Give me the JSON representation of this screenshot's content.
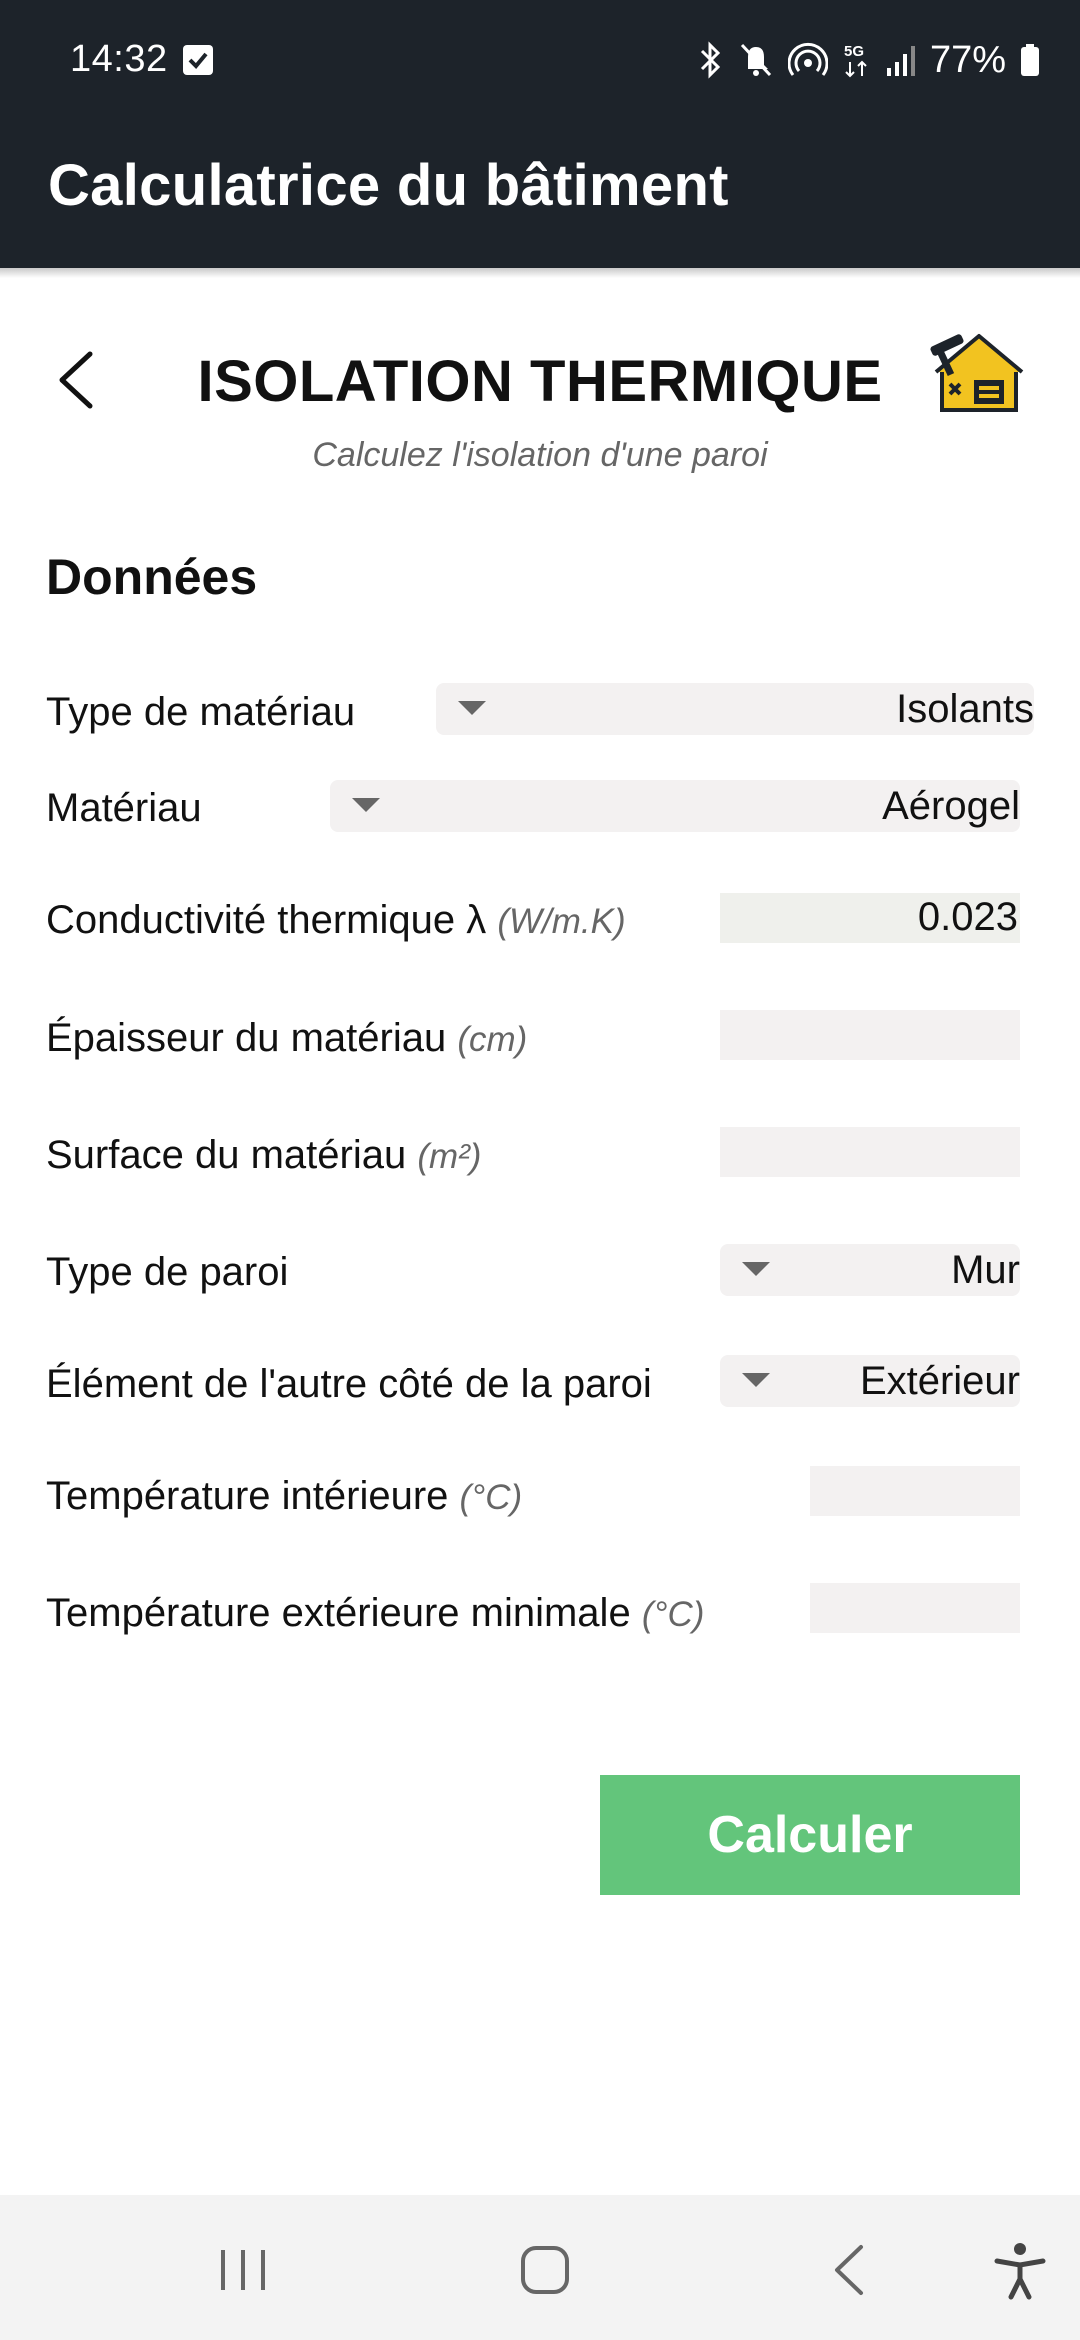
{
  "status_bar": {
    "time": "14:32",
    "battery": "77%",
    "network": "5G",
    "icons": [
      "checkbox-icon",
      "bluetooth-icon",
      "mute-icon",
      "hotspot-icon",
      "5g-icon",
      "signal-icon",
      "battery-icon"
    ]
  },
  "app_bar": {
    "title": "Calculatrice du bâtiment"
  },
  "header": {
    "title": "ISOLATION THERMIQUE",
    "subtitle": "Calculez l'isolation d'une paroi",
    "back_icon": "back-chevron-icon",
    "tool_icon": "building-calculator-icon"
  },
  "section": {
    "title": "Données"
  },
  "fields": {
    "type_materiau": {
      "label": "Type de matériau",
      "value": "Isolants"
    },
    "materiau": {
      "label": "Matériau",
      "value": "Aérogel"
    },
    "conductivite": {
      "label": "Conductivité thermique λ",
      "unit": "(W/m.K)",
      "value": "0.023"
    },
    "epaisseur": {
      "label": "Épaisseur du matériau",
      "unit": "(cm)",
      "value": ""
    },
    "surface": {
      "label": "Surface du matériau",
      "unit": "(m²)",
      "value": ""
    },
    "type_paroi": {
      "label": "Type de paroi",
      "value": "Mur"
    },
    "element_autre_cote": {
      "label": "Élément de l'autre côté de la paroi",
      "value": "Extérieur"
    },
    "temp_interieure": {
      "label": "Température intérieure",
      "unit": "(°C)",
      "value": ""
    },
    "temp_exterieure": {
      "label": "Température extérieure minimale",
      "unit": "(°C)",
      "value": ""
    }
  },
  "actions": {
    "calculate_label": "Calculer",
    "calculate_color": "#63c57b"
  },
  "nav_bar": {
    "items": [
      "recent-apps-icon",
      "home-icon",
      "back-icon",
      "accessibility-icon"
    ]
  },
  "colors": {
    "app_bar_bg": "#1d232a",
    "field_bg": "#f3f1f1",
    "accent_yellow": "#f2c320"
  }
}
